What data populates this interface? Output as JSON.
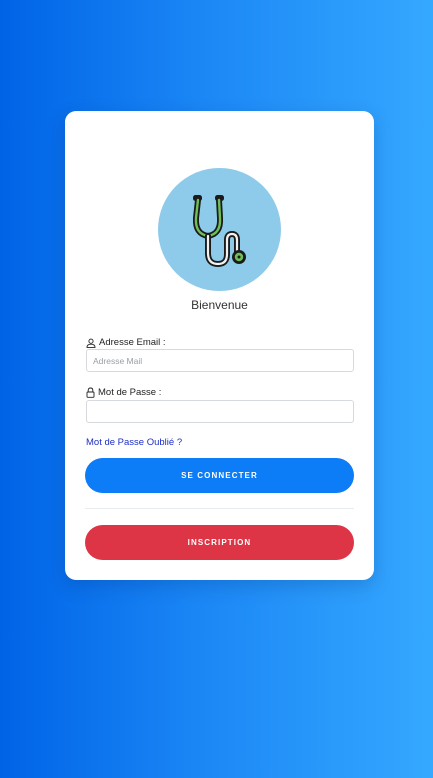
{
  "card": {
    "welcome": "Bienvenue",
    "email_label": "Adresse Email :",
    "email_placeholder": "Adresse Mail",
    "email_value": "",
    "password_label": "Mot de Passe :",
    "password_placeholder": "",
    "password_value": "",
    "forgot_link": "Mot de Passe Oublié ?",
    "login_button": "SE CONNECTER",
    "signup_button": "INSCRIPTION"
  },
  "icons": {
    "logo": "stethoscope-icon",
    "email": "user-icon",
    "password": "lock-icon"
  },
  "colors": {
    "background_start": "#0063e6",
    "background_end": "#35a8ff",
    "logo_circle": "#8ecbea",
    "primary_button": "#0d7cf7",
    "danger_button": "#dd3545",
    "link": "#1c2ec8"
  }
}
